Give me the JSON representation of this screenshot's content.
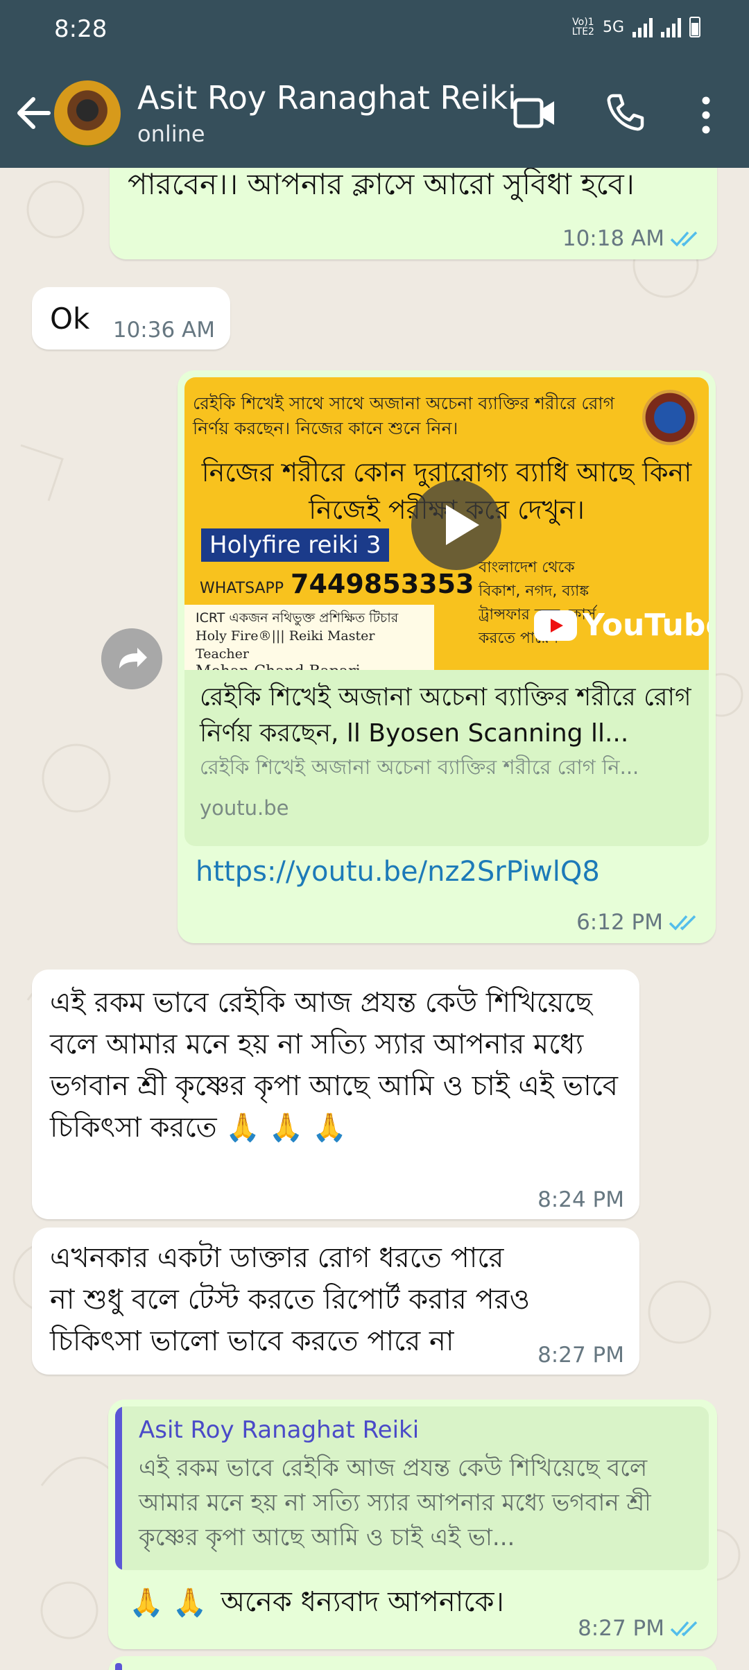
{
  "status_bar": {
    "time": "8:28",
    "network": "5G",
    "volte": "Vo)) LTE2"
  },
  "header": {
    "contact_name": "Asit Roy Ranaghat Reiki",
    "contact_status": "online"
  },
  "messages": {
    "m1": {
      "text": "পারবেন।। আপনার ক্লাসে আরো সুবিধা হবে।",
      "time": "10:18 AM"
    },
    "m2": {
      "text": "Ok",
      "time": "10:36 AM"
    },
    "m3": {
      "thumb_line1": "রেইকি শিখেই সাথে সাথে অজানা অচেনা ব্যাক্তির শরীরে রোগ নির্ণয় করছেন। নিজের কানে শুনে নিন।",
      "thumb_big": "নিজের শরীরে কোন দুরারোগ্য ব্যাধি আছে কিনা নিজেই পরীক্ষা করে দেখুন।",
      "thumb_badge": "Holyfire reiki 3",
      "thumb_wa_label": "WHATSAPP",
      "thumb_phone": "7449853353",
      "thumb_cert_1": "ICRT একজন নথিভুক্ত প্রশিক্ষিত টিচার",
      "thumb_cert_2": "Holy Fire®||| Reiki Master Teacher",
      "thumb_cert_3": "Mohan Chand Bapari",
      "thumb_bd": "বাংলাদেশ থেকে\nবিকাশ, নগদ, ব্যাঙ্ক\nট্রান্সফার করে কোর্স\nকরতে পারেন",
      "thumb_youtube": "YouTube",
      "preview_title": "রেইকি শিখেই অজানা অচেনা ব্যাক্তির শরীরে রোগ নির্ণয় করছেন, ll Byosen Scanning ll...",
      "preview_desc": "রেইকি শিখেই অজানা অচেনা ব্যাক্তির শরীরে রোগ নি...",
      "preview_domain": "youtu.be",
      "link": "https://youtu.be/nz2SrPiwlQ8",
      "time": "6:12 PM"
    },
    "m4": {
      "text": "এই রকম ভাবে রেইকি আজ প্রযন্ত কেউ শিখিয়েছে বলে আমার মনে হয় না সত্যি স্যার আপনার মধ্যে ভগবান শ্রী কৃষ্ণের কৃপা আছে আমি ও চাই এই ভাবে চিকিৎসা করতে 🙏 🙏 🙏",
      "time": "8:24 PM"
    },
    "m5": {
      "text": "এখনকার একটা ডাক্তার রোগ ধরতে পারে না শুধু বলে টেস্ট করতে রিপোর্ট করার পরও চিকিৎসা ভালো ভাবে করতে পারে না",
      "time": "8:27 PM"
    },
    "m6": {
      "quote_name": "Asit Roy Ranaghat Reiki",
      "quote_text": "এই রকম ভাবে রেইকি আজ প্রযন্ত কেউ শিখিয়েছে বলে আমার মনে হয় না সত্যি স্যার আপনার মধ্যে ভগবান শ্রী কৃষ্ণের কৃপা আছে আমি ও চাই এই ভা...",
      "emoji": "🙏 🙏",
      "text": "অনেক ধন্যবাদ আপনাকে।",
      "time": "8:27 PM"
    }
  },
  "colors": {
    "header": "#364f5b",
    "outgoing": "#e7fed8",
    "incoming": "#ffffff",
    "read_ticks": "#53bdeb",
    "link": "#1c7ab8"
  }
}
